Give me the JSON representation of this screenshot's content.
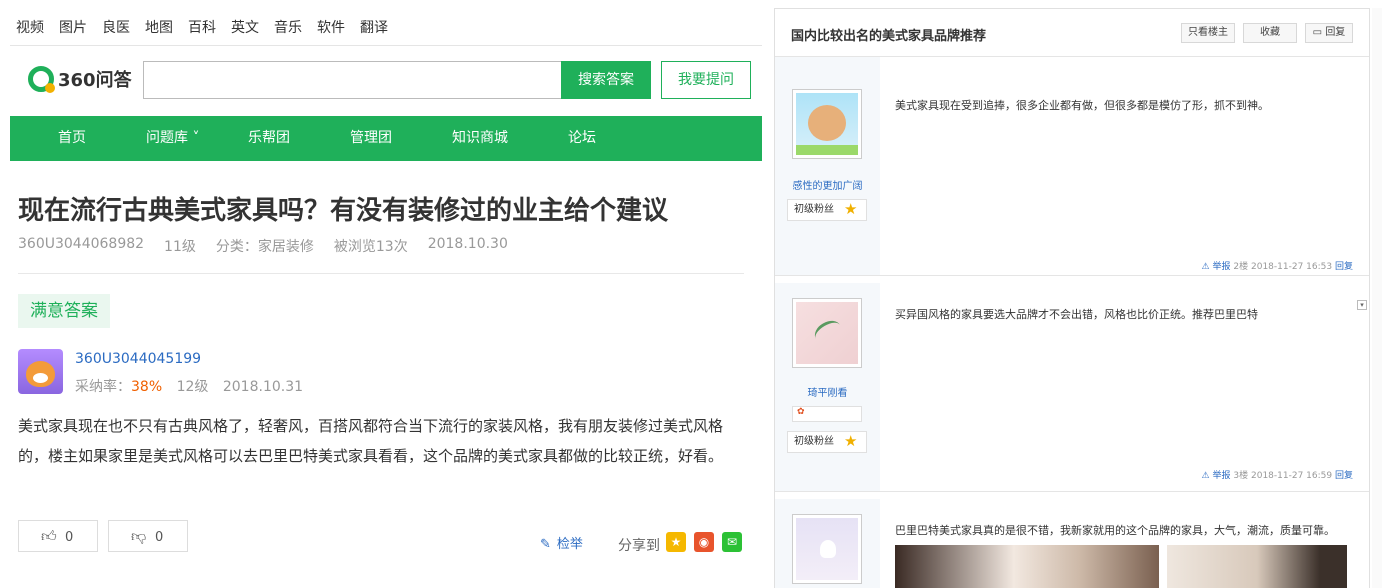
{
  "topnav": [
    "视频",
    "图片",
    "良医",
    "地图",
    "百科",
    "英文",
    "音乐",
    "软件",
    "翻译"
  ],
  "logo": {
    "text": "360问答"
  },
  "search": {
    "button": "搜索答案",
    "ask": "我要提问",
    "placeholder": ""
  },
  "mainnav": [
    "首页",
    "问题库 ˅",
    "乐帮团",
    "管理团",
    "知识商城",
    "论坛"
  ],
  "question": {
    "title": "现在流行古典美式家具吗？有没有装修过的业主给个建议",
    "user": "360U3044068982",
    "level": "11级",
    "category": "分类：家居装修",
    "views": "被浏览13次",
    "date": "2018.10.30"
  },
  "answer": {
    "tag": "满意答案",
    "user": "360U3044045199",
    "rate_label": "采纳率：",
    "rate": "38%",
    "level": "12级",
    "date": "2018.10.31",
    "body": "美式家具现在也不只有古典风格了，轻奢风，百搭风都符合当下流行的家装风格，我有朋友装修过美式风格的，楼主如果家里是美式风格可以去巴里巴特美式家具看看，这个品牌的美式家具都做的比较正统，好看。",
    "up_count": "0",
    "down_count": "0",
    "report": "检举",
    "share": "分享到"
  },
  "thread": {
    "title": "国内比较出名的美式家具品牌推荐",
    "buttons": {
      "owner": "只看楼主",
      "fav": "收藏",
      "reply": "回复"
    },
    "posts": [
      {
        "nick": "感性的更加广阔",
        "level": "初级粉丝",
        "text": "美式家具现在受到追捧，很多企业都有做，但很多都是模仿了形，抓不到神。",
        "report": "举报",
        "floor": "2楼",
        "time": "2018-11-27 16:53",
        "reply": "回复"
      },
      {
        "nick": "琦平刚看",
        "level": "初级粉丝",
        "text": "买异国风格的家具要选大品牌才不会出错，风格也比价正统。推荐巴里巴特",
        "report": "举报",
        "floor": "3楼",
        "time": "2018-11-27 16:59",
        "reply": "回复"
      },
      {
        "text": "巴里巴特美式家具真的是很不错，我新家就用的这个品牌的家具，大气，潮流，质量可靠。"
      }
    ]
  },
  "colors": {
    "green": "#1fb05a",
    "link": "#2b6bc2",
    "orange": "#f06000"
  }
}
